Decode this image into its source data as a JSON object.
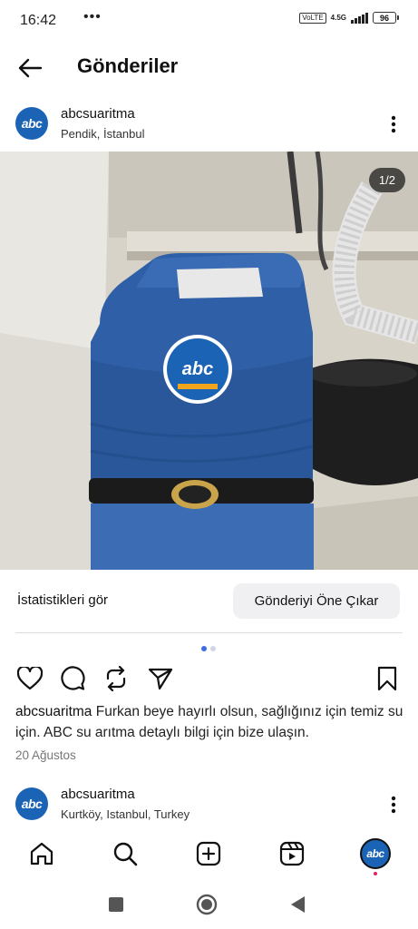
{
  "status_bar": {
    "time": "16:42",
    "dots": "•••",
    "volte": "Vo\nLTE",
    "network": "4.5G",
    "battery": "96"
  },
  "header": {
    "title": "Gönderiler"
  },
  "post": {
    "avatar_text": "abc",
    "username": "abcsuaritma",
    "location": "Pendik, İstanbul",
    "image_counter": "1/2",
    "device_logo": "abc",
    "stats_label": "İstatistikleri gör",
    "boost_label": "Gönderiyi Öne Çıkar",
    "caption_user": "abcsuaritma",
    "caption_text": " Furkan beye hayırlı olsun, sağlığınız için temiz su için. ABC su arıtma detaylı bilgi için bize ulaşın.",
    "date": "20 Ağustos",
    "carousel": {
      "total": 2,
      "active": 1
    }
  },
  "next_post": {
    "avatar_text": "abc",
    "username": "abcsuaritma",
    "location": "Kurtköy, Istanbul, Turkey"
  },
  "icons": {
    "back": "arrow-left-icon",
    "more": "more-vertical-icon",
    "like": "heart-icon",
    "comment": "comment-icon",
    "repost": "repost-icon",
    "share": "send-icon",
    "save": "bookmark-icon",
    "home": "home-icon",
    "search": "search-icon",
    "create": "plus-square-icon",
    "reels": "reels-icon",
    "profile": "profile-avatar-icon"
  },
  "colors": {
    "brand": "#1b63b5",
    "accent": "#3b6fe0",
    "notification": "#e0245e"
  }
}
